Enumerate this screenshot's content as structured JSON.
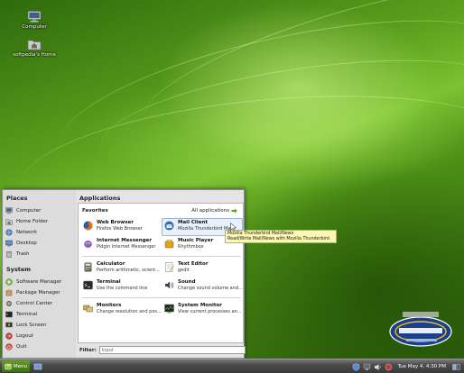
{
  "desktop": {
    "icons": [
      {
        "label": "Computer",
        "icon": "computer-icon"
      },
      {
        "label": "softpedia's Home",
        "icon": "home-folder-icon"
      }
    ]
  },
  "menu": {
    "places_title": "Places",
    "places": [
      {
        "label": "Computer",
        "icon": "computer-icon"
      },
      {
        "label": "Home Folder",
        "icon": "home-folder-icon"
      },
      {
        "label": "Network",
        "icon": "network-icon"
      },
      {
        "label": "Desktop",
        "icon": "desktop-icon"
      },
      {
        "label": "Trash",
        "icon": "trash-icon"
      }
    ],
    "system_title": "System",
    "system": [
      {
        "label": "Software Manager",
        "icon": "software-manager-icon"
      },
      {
        "label": "Package Manager",
        "icon": "package-manager-icon"
      },
      {
        "label": "Control Center",
        "icon": "control-center-icon"
      },
      {
        "label": "Terminal",
        "icon": "terminal-icon"
      },
      {
        "label": "Lock Screen",
        "icon": "lock-screen-icon"
      },
      {
        "label": "Logout",
        "icon": "logout-icon"
      },
      {
        "label": "Quit",
        "icon": "quit-icon"
      }
    ],
    "applications_title": "Applications",
    "favorites_title": "Favorites",
    "all_applications_label": "All applications",
    "apps": [
      {
        "name": "Web Browser",
        "desc": "Firefox Web Browser",
        "icon": "firefox-icon"
      },
      {
        "name": "Mail Client",
        "desc": "Mozilla Thunderbird Mai",
        "icon": "thunderbird-icon"
      },
      {
        "name": "Internet Messenger",
        "desc": "Pidgin Internet Messenger",
        "icon": "pidgin-icon"
      },
      {
        "name": "Music Player",
        "desc": "Rhythmbox",
        "icon": "rhythmbox-icon"
      },
      {
        "name": "Calculator",
        "desc": "Perform arithmetic, scient...",
        "icon": "calculator-icon"
      },
      {
        "name": "Text Editor",
        "desc": "gedit",
        "icon": "text-editor-icon"
      },
      {
        "name": "Terminal",
        "desc": "Use the command line",
        "icon": "terminal-icon"
      },
      {
        "name": "Sound",
        "desc": "Change sound volume and...",
        "icon": "sound-icon"
      },
      {
        "name": "Monitors",
        "desc": "Change resolution and pos...",
        "icon": "monitors-icon"
      },
      {
        "name": "System Monitor",
        "desc": "View current processes an...",
        "icon": "system-monitor-icon"
      }
    ],
    "filter_label": "Filter:",
    "filter_value": "Input"
  },
  "tooltip": {
    "line1": "Mozilla Thunderbird Mail/News",
    "line2": "Read/Write Mail/News with Mozilla Thunderbird"
  },
  "taskbar": {
    "menu_label": "Menu",
    "clock": "Tue May  4,  4:30 PM"
  },
  "colors": {
    "wallpaper_green": "#5ea21e",
    "menu_background": "#d8d8d8",
    "tooltip_background": "#fbf7b4",
    "taskbar_dark": "#3a3a3a"
  }
}
